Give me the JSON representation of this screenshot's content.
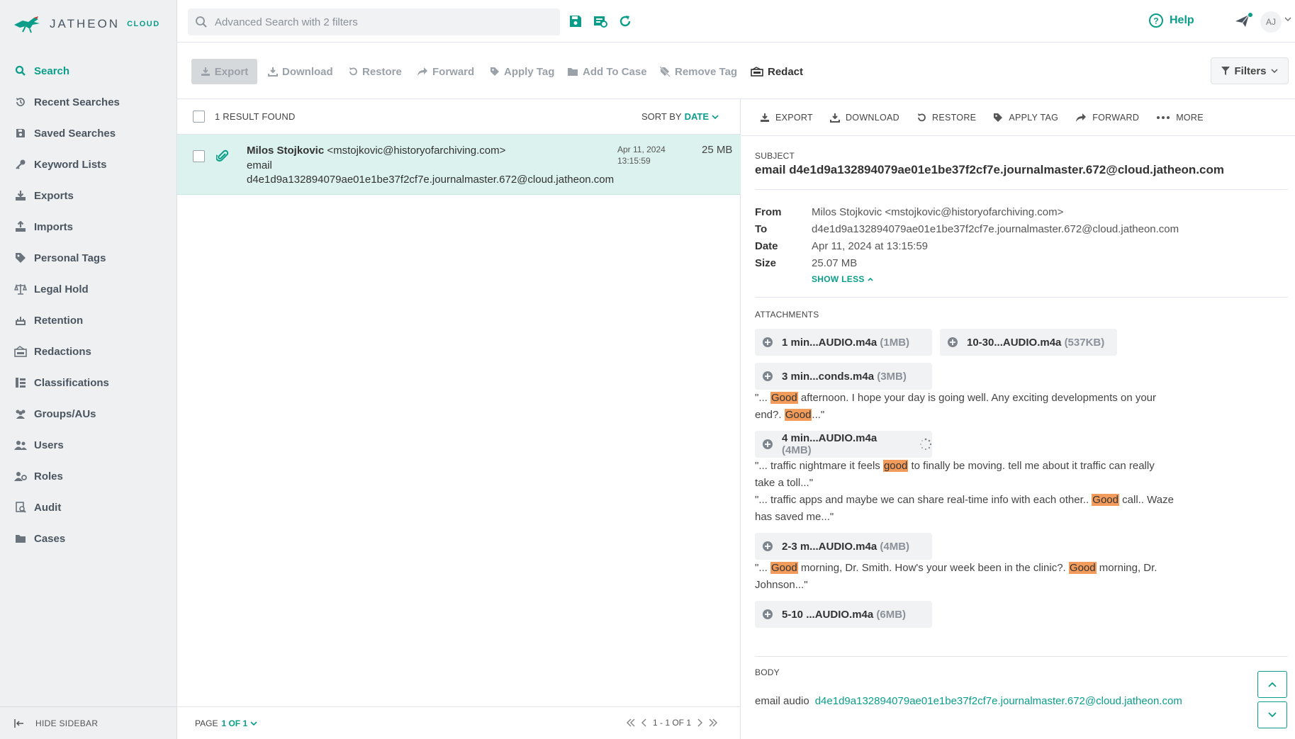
{
  "app": {
    "logo_text": "JATHEON",
    "logo_sub": "CLOUD"
  },
  "sidebar": {
    "items": [
      {
        "label": "Search",
        "icon": "search-icon",
        "active": true
      },
      {
        "label": "Recent Searches",
        "icon": "history-icon"
      },
      {
        "label": "Saved Searches",
        "icon": "save-icon"
      },
      {
        "label": "Keyword Lists",
        "icon": "key-icon"
      },
      {
        "label": "Exports",
        "icon": "export-icon"
      },
      {
        "label": "Imports",
        "icon": "import-icon"
      },
      {
        "label": "Personal Tags",
        "icon": "tag-icon"
      },
      {
        "label": "Legal Hold",
        "icon": "scale-icon"
      },
      {
        "label": "Retention",
        "icon": "retention-icon"
      },
      {
        "label": "Redactions",
        "icon": "redact-icon"
      },
      {
        "label": "Classifications",
        "icon": "classification-icon"
      },
      {
        "label": "Groups/AUs",
        "icon": "groups-icon"
      },
      {
        "label": "Users",
        "icon": "users-icon"
      },
      {
        "label": "Roles",
        "icon": "roles-icon"
      },
      {
        "label": "Audit",
        "icon": "audit-icon"
      },
      {
        "label": "Cases",
        "icon": "folder-icon"
      }
    ],
    "hide_label": "HIDE SIDEBAR"
  },
  "topbar": {
    "search_placeholder": "Advanced Search with 2 filters",
    "help_label": "Help",
    "avatar_initials": "AJ"
  },
  "toolbar": {
    "export": "Export",
    "download": "Download",
    "restore": "Restore",
    "forward": "Forward",
    "apply_tag": "Apply Tag",
    "add_to_case": "Add To Case",
    "remove_tag": "Remove Tag",
    "redact": "Redact",
    "filters": "Filters"
  },
  "results": {
    "count_label": "1 RESULT FOUND",
    "sort_label": "SORT BY",
    "sort_value": "DATE",
    "rows": [
      {
        "sender_name": "Milos Stojkovic",
        "sender_email": "<mstojkovic@historyofarchiving.com>",
        "subject_line1": "email",
        "subject_line2": "d4e1d9a132894079ae01e1be37f2cf7e.journalmaster.672@cloud.jatheon.com",
        "date": "Apr 11, 2024",
        "time": "13:15:59",
        "size": "25 MB"
      }
    ],
    "page_label": "PAGE",
    "page_value": "1 OF 1",
    "range_label": "1 - 1 OF 1"
  },
  "detail": {
    "actions": {
      "export": "EXPORT",
      "download": "DOWNLOAD",
      "restore": "RESTORE",
      "apply_tag": "APPLY TAG",
      "forward": "FORWARD",
      "more": "MORE"
    },
    "subject_label": "SUBJECT",
    "subject": "email d4e1d9a132894079ae01e1be37f2cf7e.journalmaster.672@cloud.jatheon.com",
    "meta": {
      "from_k": "From",
      "from_v": "Milos Stojkovic <mstojkovic@historyofarchiving.com>",
      "to_k": "To",
      "to_v": "d4e1d9a132894079ae01e1be37f2cf7e.journalmaster.672@cloud.jatheon.com",
      "date_k": "Date",
      "date_v": "Apr 11, 2024 at 13:15:59",
      "size_k": "Size",
      "size_v": "25.07 MB",
      "show_less": "SHOW LESS"
    },
    "attachments_label": "ATTACHMENTS",
    "attachments": [
      {
        "name": "1 min...AUDIO.m4a",
        "size": "(1MB)"
      },
      {
        "name": "10-30...AUDIO.m4a",
        "size": "(537KB)"
      },
      {
        "name": "3 min...conds.m4a",
        "size": "(3MB)"
      },
      {
        "name": "4 min...AUDIO.m4a",
        "size": "(4MB)"
      },
      {
        "name": "2-3 m...AUDIO.m4a",
        "size": "(4MB)"
      },
      {
        "name": "5-10 ...AUDIO.m4a",
        "size": "(6MB)"
      }
    ],
    "snippets": {
      "s1_a": "\"... ",
      "s1_hl1": "Good",
      "s1_b": " afternoon. I hope your day is going well. Any exciting developments on your end?. ",
      "s1_hl2": "Good",
      "s1_c": "...\"",
      "s2_a": "\"... traffic nightmare it feels ",
      "s2_hl": "good",
      "s2_b": " to finally be moving. tell me about it traffic can really take a toll...\"",
      "s3_a": "\"... traffic apps and maybe we can share real-time info with each other.. ",
      "s3_hl": "Good",
      "s3_b": " call.. Waze has saved me...\"",
      "s4_a": "\"... ",
      "s4_hl1": "Good",
      "s4_b": " morning, Dr. Smith. How's your week been in the clinic?. ",
      "s4_hl2": "Good",
      "s4_c": " morning, Dr. Johnson...\""
    },
    "body_label": "BODY",
    "body_text": "email audio",
    "body_link": "d4e1d9a132894079ae01e1be37f2cf7e.journalmaster.672@cloud.jatheon.com"
  },
  "colors": {
    "accent": "#0a9e8a",
    "highlight": "#f29b5a",
    "selected_row": "#dcf2ee",
    "sidebar_bg": "#eef0f2"
  }
}
